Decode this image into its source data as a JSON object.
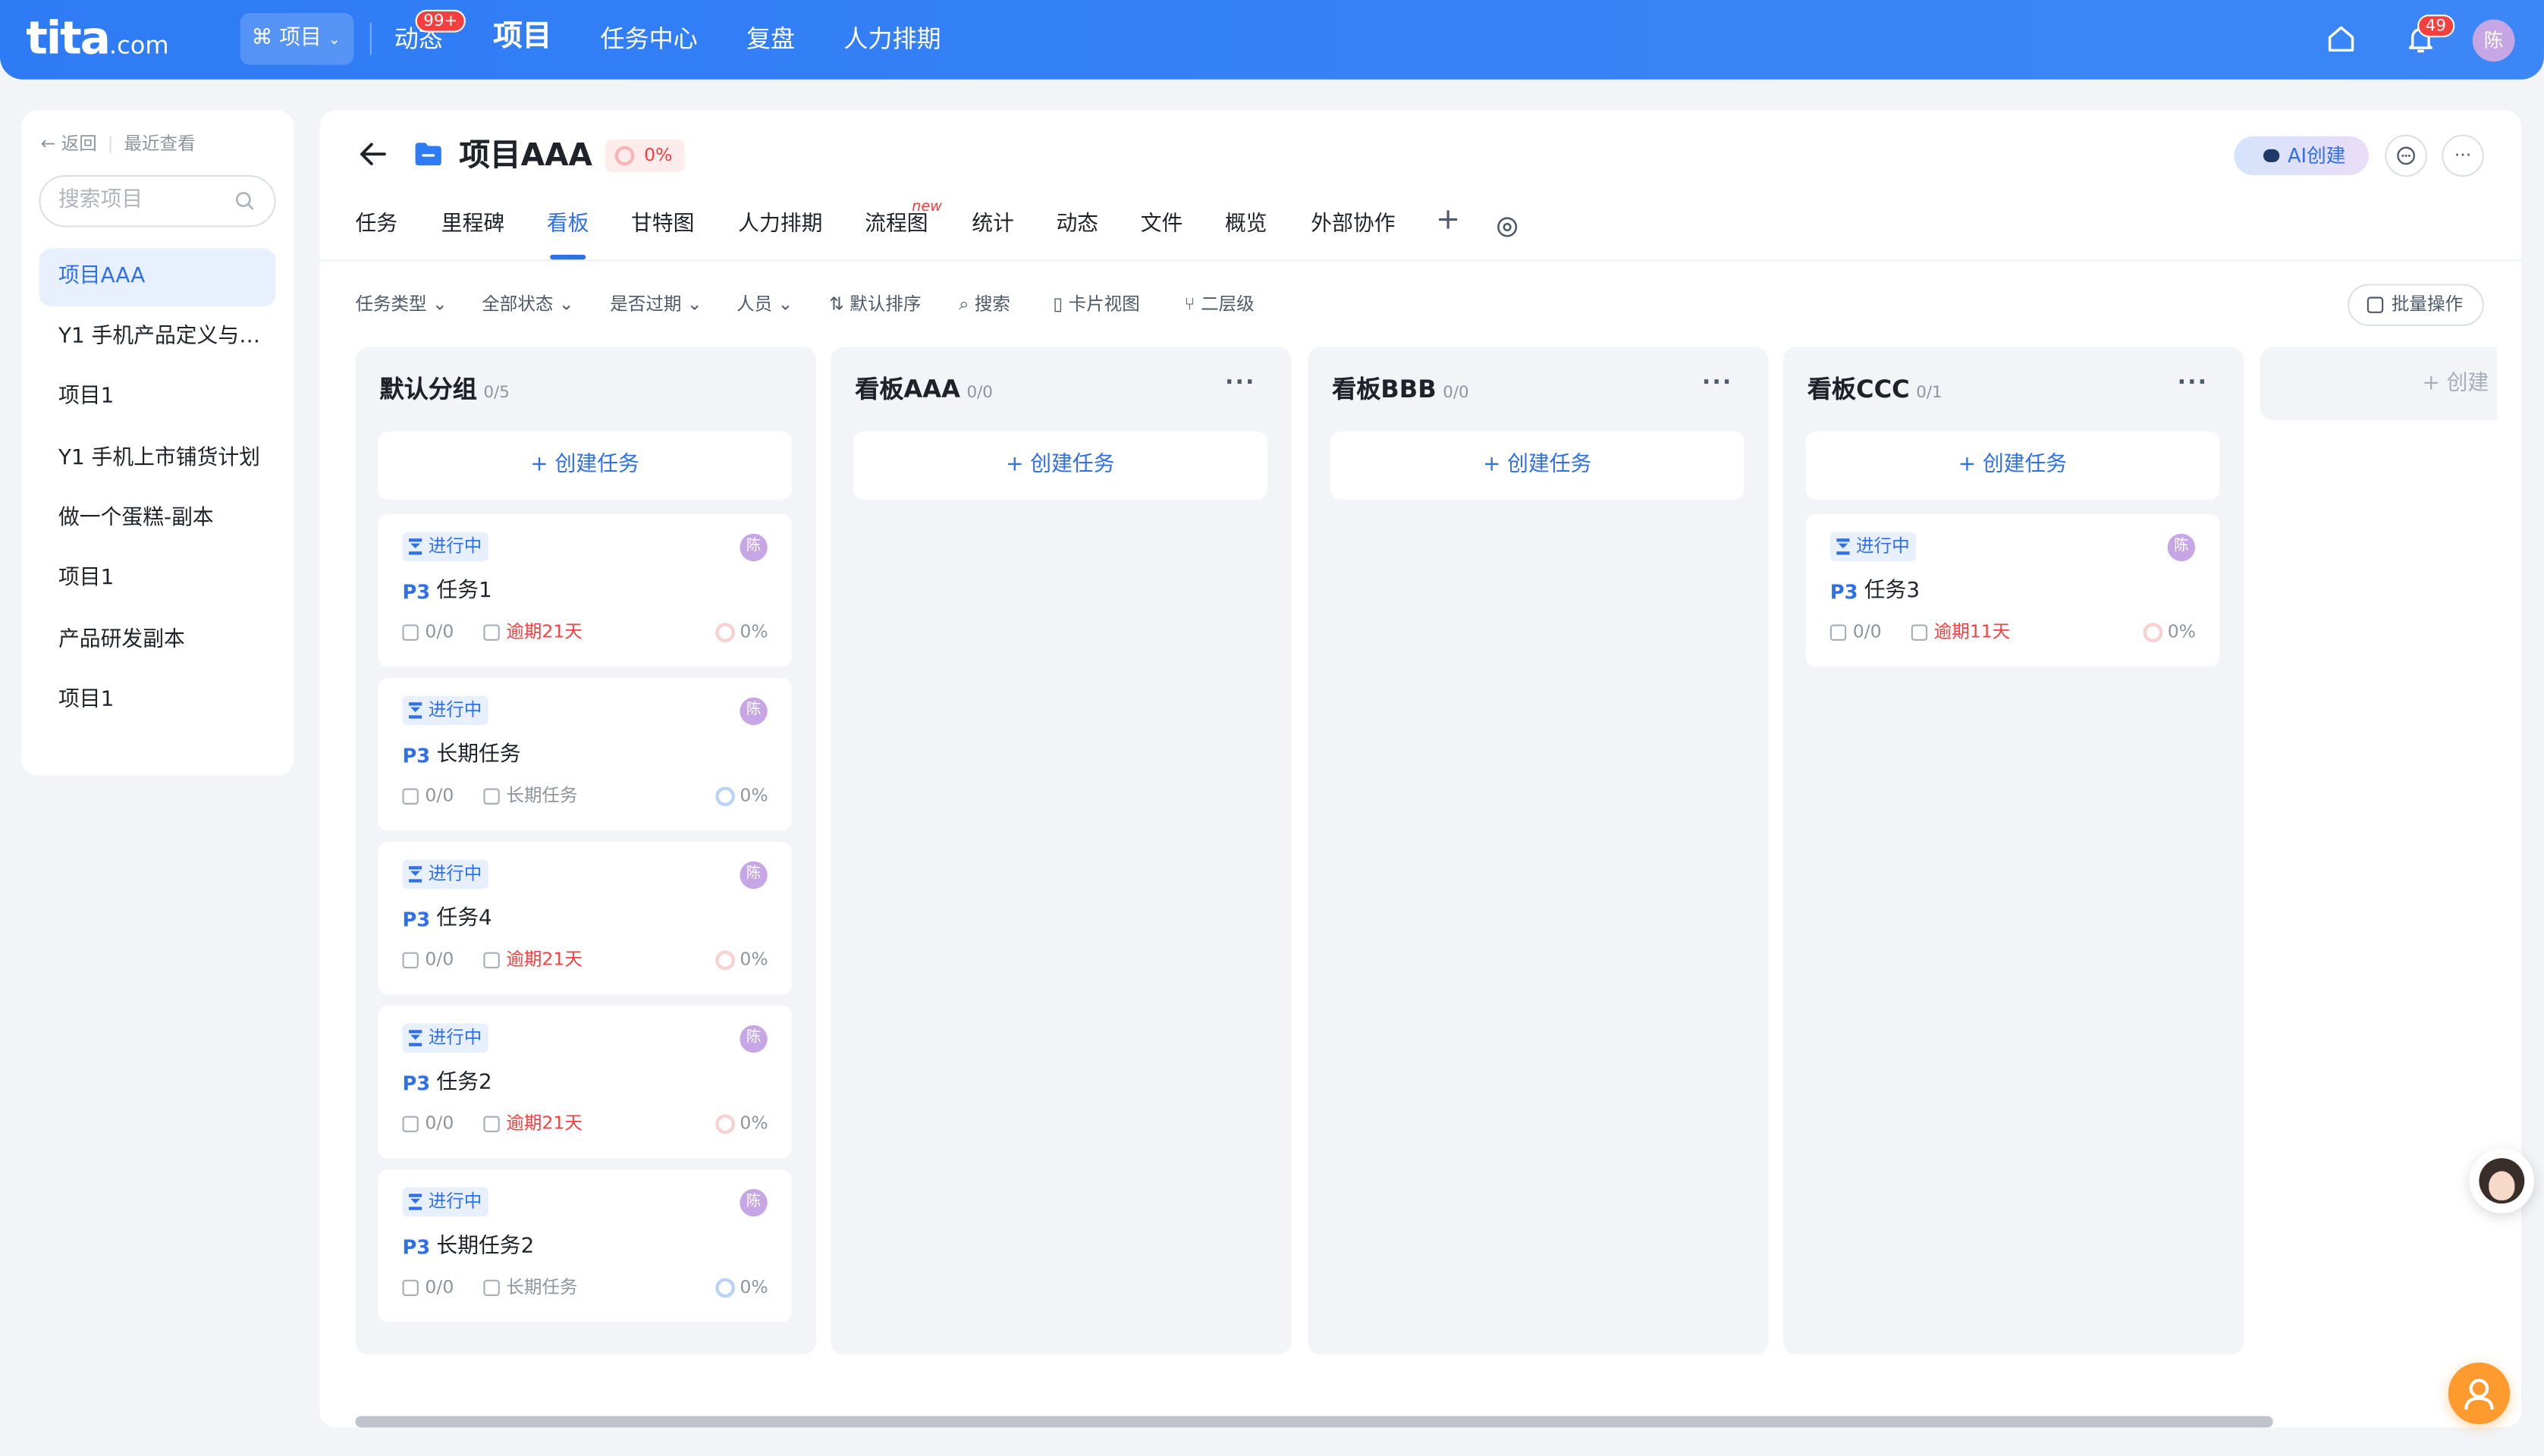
{
  "topbar": {
    "logo": "tita",
    "logo_suffix": ".com",
    "project_switch": "项目",
    "nav": [
      {
        "label": "动态",
        "badge": "99+"
      },
      {
        "label": "项目"
      },
      {
        "label": "任务中心"
      },
      {
        "label": "复盘"
      },
      {
        "label": "人力排期"
      }
    ],
    "notification_badge": "49",
    "avatar": "陈"
  },
  "sidebar": {
    "back": "返回",
    "recent": "最近查看",
    "search_placeholder": "搜索项目",
    "items": [
      {
        "label": "项目AAA",
        "active": true
      },
      {
        "label": "Y1 手机产品定义与规划"
      },
      {
        "label": "项目1"
      },
      {
        "label": "Y1 手机上市铺货计划"
      },
      {
        "label": "做一个蛋糕-副本"
      },
      {
        "label": "项目1"
      },
      {
        "label": "产品研发副本"
      },
      {
        "label": "项目1"
      }
    ]
  },
  "header": {
    "title": "项目AAA",
    "progress": "0%",
    "ai_button": "AI创建",
    "more": "···"
  },
  "tabs": [
    {
      "label": "任务"
    },
    {
      "label": "里程碑"
    },
    {
      "label": "看板",
      "active": true
    },
    {
      "label": "甘特图"
    },
    {
      "label": "人力排期"
    },
    {
      "label": "流程图",
      "tag": "new"
    },
    {
      "label": "统计"
    },
    {
      "label": "动态"
    },
    {
      "label": "文件"
    },
    {
      "label": "概览"
    },
    {
      "label": "外部协作"
    },
    {
      "label": "+"
    }
  ],
  "filters": {
    "task_type": "任务类型",
    "all_status": "全部状态",
    "overdue": "是否过期",
    "people": "人员",
    "sort": "默认排序",
    "search": "搜索",
    "card_view": "卡片视图",
    "level": "二层级",
    "batch": "批量操作"
  },
  "board": {
    "create_task": "+ 创建任务",
    "more": "···",
    "add_column": "+ 创建",
    "columns": [
      {
        "title": "默认分组",
        "count": "0/5",
        "cards": [
          {
            "status": "进行中",
            "priority": "P3",
            "name": "任务1",
            "checks": "0/0",
            "due": "逾期21天",
            "overdue": true,
            "progress": "0%",
            "avatar": "陈"
          },
          {
            "status": "进行中",
            "priority": "P3",
            "name": "长期任务",
            "checks": "0/0",
            "due": "长期任务",
            "overdue": false,
            "progress": "0%",
            "avatar": "陈"
          },
          {
            "status": "进行中",
            "priority": "P3",
            "name": "任务4",
            "checks": "0/0",
            "due": "逾期21天",
            "overdue": true,
            "progress": "0%",
            "avatar": "陈"
          },
          {
            "status": "进行中",
            "priority": "P3",
            "name": "任务2",
            "checks": "0/0",
            "due": "逾期21天",
            "overdue": true,
            "progress": "0%",
            "avatar": "陈"
          },
          {
            "status": "进行中",
            "priority": "P3",
            "name": "长期任务2",
            "checks": "0/0",
            "due": "长期任务",
            "overdue": false,
            "progress": "0%",
            "avatar": "陈"
          }
        ]
      },
      {
        "title": "看板AAA",
        "count": "0/0",
        "cards": []
      },
      {
        "title": "看板BBB",
        "count": "0/0",
        "cards": []
      },
      {
        "title": "看板CCC",
        "count": "0/1",
        "cards": [
          {
            "status": "进行中",
            "priority": "P3",
            "name": "任务3",
            "checks": "0/0",
            "due": "逾期11天",
            "overdue": true,
            "progress": "0%",
            "avatar": "陈"
          }
        ]
      }
    ]
  },
  "colors": {
    "brand": "#2F7BF5",
    "accent": "#2F6FE8",
    "danger": "#F53F3F",
    "avatar": "#C7A6E6",
    "help": "#FF9A2E"
  }
}
